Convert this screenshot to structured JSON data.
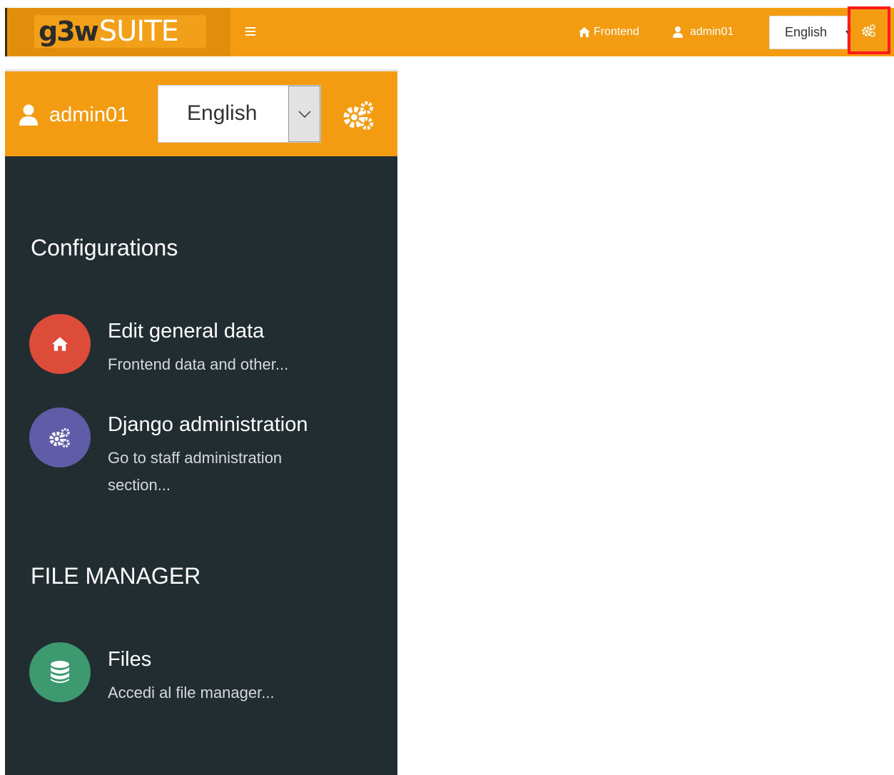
{
  "navbar": {
    "logo": {
      "brand_bold": "g3w",
      "brand_light": "SUITE"
    },
    "frontend_link": "Frontend",
    "user_link": "admin01",
    "language_selected": "English"
  },
  "panel": {
    "user": "admin01",
    "language_selected": "English",
    "sections": [
      {
        "title": "Configurations",
        "items": [
          {
            "title": "Edit general data",
            "description": "Frontend data and other...",
            "icon": "home-icon",
            "color": "#dd4b39"
          },
          {
            "title": "Django administration",
            "description": "Go to staff administration section...",
            "icon": "gears-icon",
            "color": "#605ca8"
          }
        ]
      },
      {
        "title": "FILE MANAGER",
        "items": [
          {
            "title": "Files",
            "description": "Accedi al file manager...",
            "icon": "database-icon",
            "color": "#3d9970"
          }
        ]
      }
    ]
  },
  "colors": {
    "navbar": "#f39c12",
    "logo_bg": "#e08e0b",
    "panel_bg": "#222d32",
    "highlight": "#ff1a1a"
  }
}
